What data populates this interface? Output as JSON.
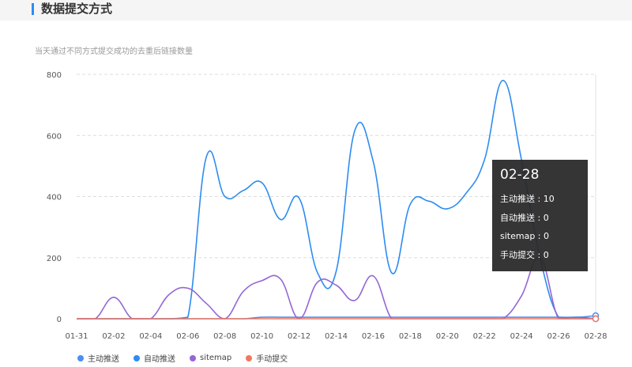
{
  "header": {
    "title": "数据提交方式"
  },
  "subtitle": "当天通过不同方式提交成功的去重后链接数量",
  "colors": {
    "series_active": "#4e8ef0",
    "series_auto": "#2d8cf0",
    "series_sitemap": "#9467d4",
    "series_manual": "#f07860",
    "grid": "#dddddd",
    "tooltip_bg": "#282828"
  },
  "chart_data": {
    "type": "line",
    "dates": [
      "01-31",
      "02-01",
      "02-02",
      "02-03",
      "02-04",
      "02-05",
      "02-06",
      "02-07",
      "02-08",
      "02-09",
      "02-10",
      "02-11",
      "02-12",
      "02-13",
      "02-14",
      "02-15",
      "02-16",
      "02-17",
      "02-18",
      "02-19",
      "02-20",
      "02-21",
      "02-22",
      "02-23",
      "02-24",
      "02-25",
      "02-26",
      "02-27",
      "02-28"
    ],
    "x_ticks": [
      "01-31",
      "02-02",
      "02-04",
      "02-06",
      "02-08",
      "02-10",
      "02-12",
      "02-14",
      "02-16",
      "02-18",
      "02-20",
      "02-22",
      "02-24",
      "02-26",
      "02-28"
    ],
    "y_ticks": [
      "800",
      "600",
      "400",
      "200",
      "0"
    ],
    "ylim": [
      0,
      800
    ],
    "series": [
      {
        "name": "主动推送",
        "color": "#4e8ef0",
        "values": [
          0,
          0,
          0,
          0,
          0,
          0,
          0,
          0,
          0,
          0,
          5,
          5,
          5,
          5,
          5,
          5,
          5,
          5,
          5,
          5,
          5,
          5,
          5,
          5,
          5,
          5,
          5,
          5,
          10
        ]
      },
      {
        "name": "自动推送",
        "color": "#2d8cf0",
        "values": [
          0,
          0,
          0,
          0,
          0,
          0,
          5,
          530,
          400,
          420,
          445,
          325,
          395,
          150,
          155,
          615,
          515,
          150,
          375,
          385,
          360,
          410,
          520,
          780,
          520,
          200,
          5,
          5,
          0
        ]
      },
      {
        "name": "sitemap",
        "color": "#9467d4",
        "values": [
          0,
          0,
          70,
          0,
          0,
          80,
          100,
          50,
          0,
          90,
          125,
          130,
          0,
          120,
          110,
          60,
          140,
          0,
          0,
          0,
          0,
          0,
          0,
          0,
          75,
          200,
          0,
          0,
          0
        ]
      },
      {
        "name": "手动提交",
        "color": "#f07860",
        "values": [
          0,
          0,
          0,
          0,
          0,
          0,
          0,
          0,
          0,
          0,
          0,
          0,
          0,
          0,
          0,
          0,
          0,
          0,
          0,
          0,
          0,
          0,
          0,
          0,
          0,
          0,
          0,
          0,
          0
        ]
      }
    ]
  },
  "tooltip": {
    "date": "02-28",
    "rows": [
      "主动推送 : 10",
      "自动推送 : 0",
      "sitemap : 0",
      "手动提交 : 0"
    ]
  },
  "legend": [
    "主动推送",
    "自动推送",
    "sitemap",
    "手动提交"
  ]
}
